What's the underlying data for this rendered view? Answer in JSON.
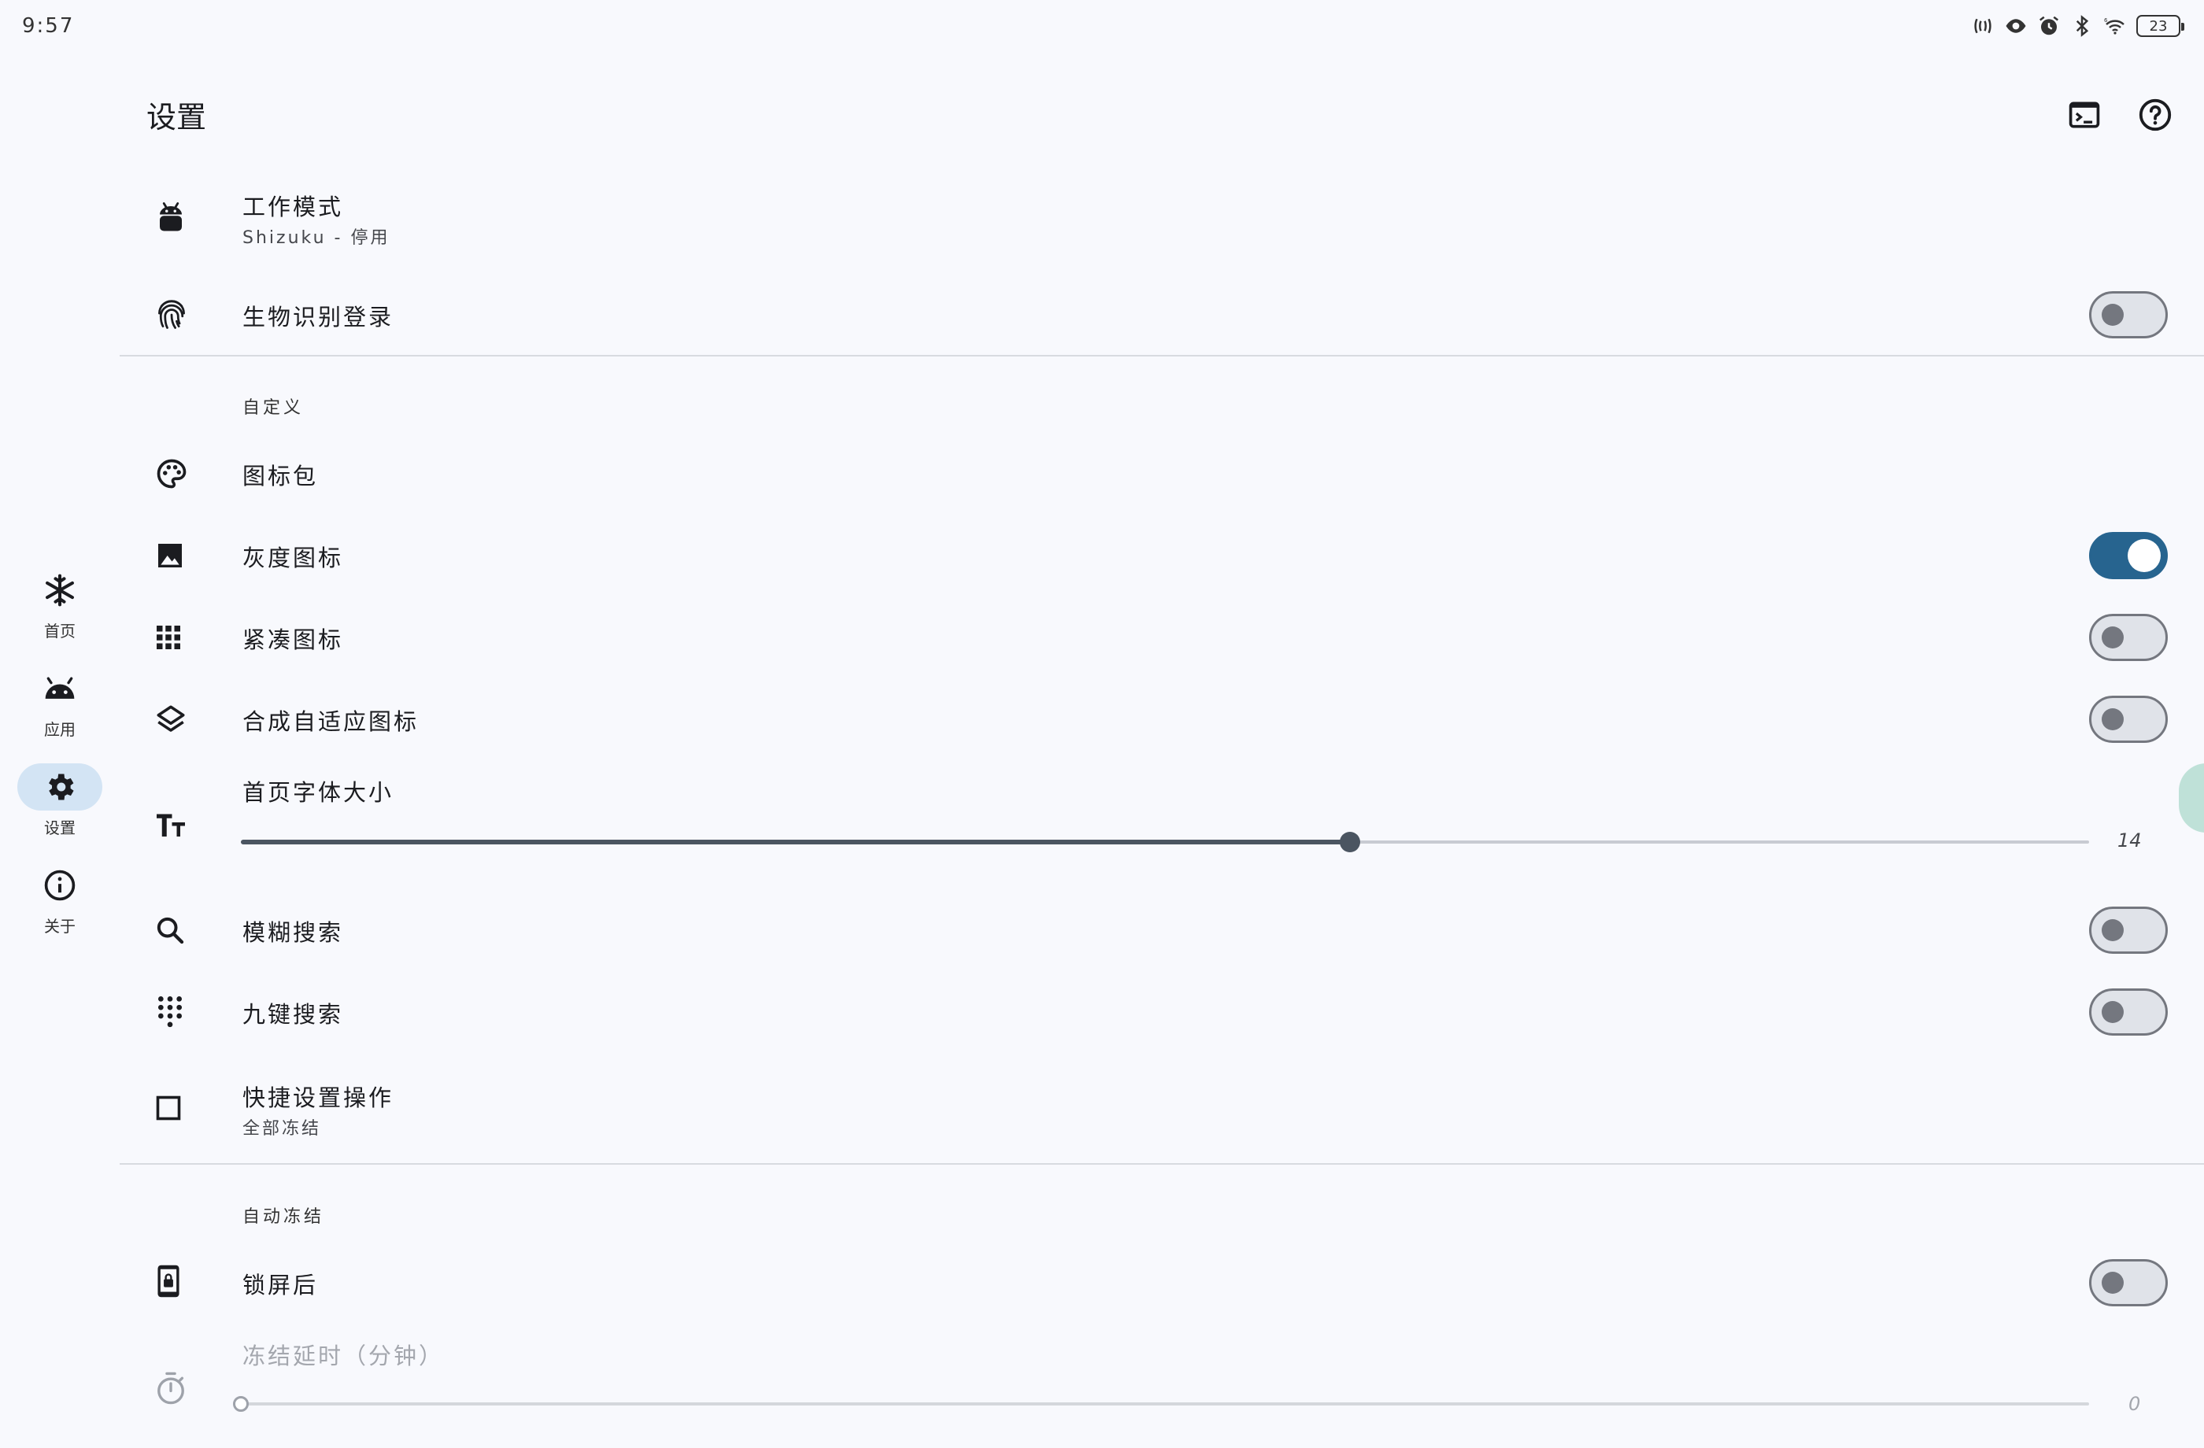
{
  "status_bar": {
    "time": "9:57",
    "battery": "23",
    "icons": [
      "nfc-icon",
      "eye-icon",
      "alarm-icon",
      "bluetooth-icon",
      "wifi-6-icon",
      "battery-icon"
    ]
  },
  "nav_rail": {
    "items": [
      {
        "label": "首页",
        "icon": "snowflake-icon"
      },
      {
        "label": "应用",
        "icon": "android-icon"
      },
      {
        "label": "设置",
        "icon": "gear-icon",
        "active": true
      },
      {
        "label": "关于",
        "icon": "info-icon"
      }
    ]
  },
  "top_bar": {
    "title": "设置",
    "actions": [
      "terminal-icon",
      "help-icon"
    ]
  },
  "settings": {
    "work_mode": {
      "title": "工作模式",
      "subtitle": "Shizuku - 停用",
      "icon": "android-robot-icon"
    },
    "biometric": {
      "title": "生物识别登录",
      "icon": "fingerprint-icon",
      "enabled": false
    },
    "customize_header": "自定义",
    "icon_pack": {
      "title": "图标包",
      "icon": "palette-icon"
    },
    "grayscale_icons": {
      "title": "灰度图标",
      "icon": "monochrome-photo-icon",
      "enabled": true
    },
    "compact_icons": {
      "title": "紧凑图标",
      "icon": "grid-icon",
      "enabled": false
    },
    "adaptive_icons": {
      "title": "合成自适应图标",
      "icon": "layers-icon",
      "enabled": false
    },
    "font_size": {
      "title": "首页字体大小",
      "icon": "text-size-icon",
      "value": "14",
      "fraction": 0.6
    },
    "fuzzy_search": {
      "title": "模糊搜索",
      "icon": "search-icon",
      "enabled": false
    },
    "t9_search": {
      "title": "九键搜索",
      "icon": "dialpad-icon",
      "enabled": false
    },
    "quick_setting": {
      "title": "快捷设置操作",
      "subtitle": "全部冻结",
      "icon": "checkbox-outline-icon"
    },
    "auto_freeze_header": "自动冻结",
    "after_lock": {
      "title": "锁屏后",
      "icon": "phone-lock-icon",
      "enabled": false
    },
    "freeze_delay": {
      "title": "冻结延时（分钟）",
      "icon": "timer-icon",
      "value": "0",
      "fraction": 0.0
    }
  },
  "colors": {
    "accent": "#27648f",
    "background": "#f8f9fd",
    "rail_active": "#d3e4f4"
  }
}
